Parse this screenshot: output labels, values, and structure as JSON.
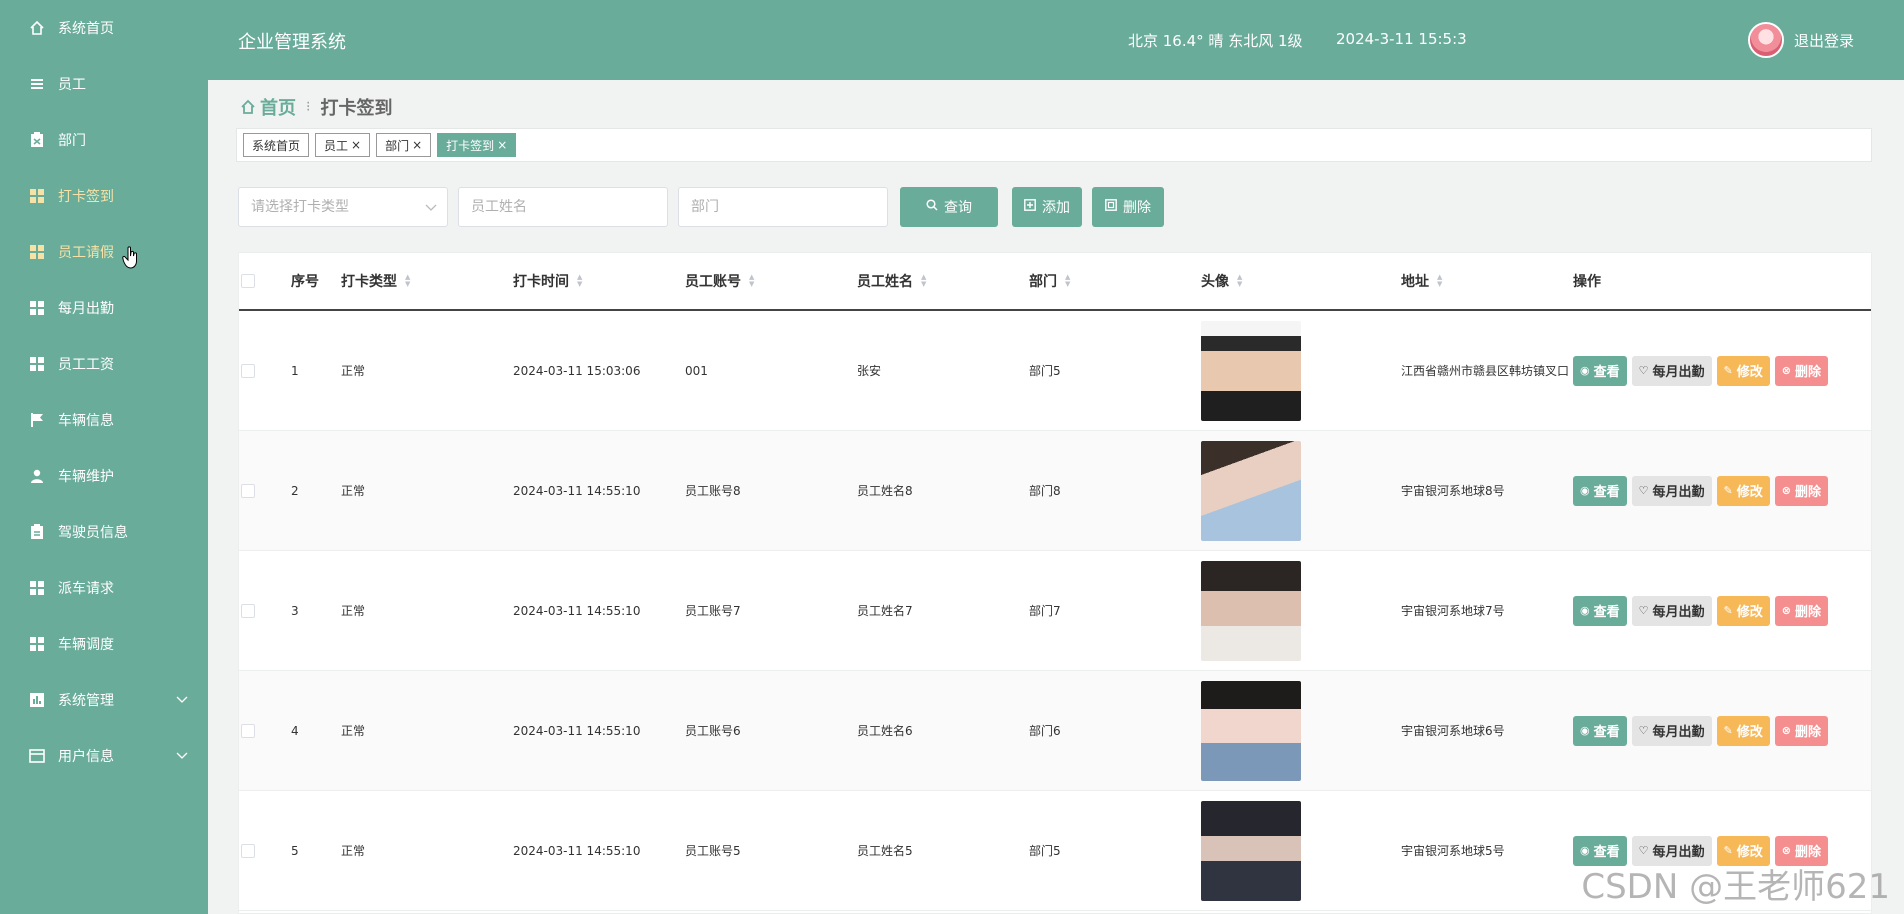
{
  "colors": {
    "primary": "#6aac9a",
    "active_menu": "#f6e2a6",
    "edit": "#f7b858",
    "delete": "#f58e8e",
    "monthly": "#e4e4e4"
  },
  "sidebar": {
    "items": [
      {
        "label": "系统首页",
        "icon": "home-icon"
      },
      {
        "label": "员工",
        "icon": "list-icon"
      },
      {
        "label": "部门",
        "icon": "clipboard-icon"
      },
      {
        "label": "打卡签到",
        "icon": "grid-icon"
      },
      {
        "label": "员工请假",
        "icon": "grid-icon"
      },
      {
        "label": "每月出勤",
        "icon": "grid-icon"
      },
      {
        "label": "员工工资",
        "icon": "grid-icon"
      },
      {
        "label": "车辆信息",
        "icon": "flag-icon"
      },
      {
        "label": "车辆维护",
        "icon": "user-icon"
      },
      {
        "label": "驾驶员信息",
        "icon": "clipboard-icon"
      },
      {
        "label": "派车请求",
        "icon": "grid-icon"
      },
      {
        "label": "车辆调度",
        "icon": "grid-icon"
      },
      {
        "label": "系统管理",
        "icon": "chart-icon"
      },
      {
        "label": "用户信息",
        "icon": "card-icon"
      }
    ]
  },
  "header": {
    "title": "企业管理系统",
    "weather": "北京  16.4°  晴  东北风  1级",
    "datetime": "2024-3-11 15:5:3",
    "logout": "退出登录"
  },
  "breadcrumb": {
    "home": "首页",
    "current": "打卡签到"
  },
  "tags": [
    {
      "label": "系统首页",
      "closable": false
    },
    {
      "label": "员工",
      "closable": true
    },
    {
      "label": "部门",
      "closable": true
    },
    {
      "label": "打卡签到",
      "closable": true
    }
  ],
  "filters": {
    "type_placeholder": "请选择打卡类型",
    "name_placeholder": "员工姓名",
    "dept_placeholder": "部门",
    "search": "查询",
    "add": "添加",
    "delete": "删除"
  },
  "table": {
    "columns": [
      "序号",
      "打卡类型",
      "打卡时间",
      "员工账号",
      "员工姓名",
      "部门",
      "头像",
      "地址",
      "操作"
    ],
    "actions": {
      "view": "查看",
      "monthly": "每月出勤",
      "edit": "修改",
      "delete": "删除"
    },
    "rows": [
      {
        "no": "1",
        "type": "正常",
        "time": "2024-03-11 15:03:06",
        "account": "001",
        "name": "张安",
        "dept": "部门5",
        "address": "江西省赣州市赣县区韩坊镇叉口"
      },
      {
        "no": "2",
        "type": "正常",
        "time": "2024-03-11 14:55:10",
        "account": "员工账号8",
        "name": "员工姓名8",
        "dept": "部门8",
        "address": "宇宙银河系地球8号"
      },
      {
        "no": "3",
        "type": "正常",
        "time": "2024-03-11 14:55:10",
        "account": "员工账号7",
        "name": "员工姓名7",
        "dept": "部门7",
        "address": "宇宙银河系地球7号"
      },
      {
        "no": "4",
        "type": "正常",
        "time": "2024-03-11 14:55:10",
        "account": "员工账号6",
        "name": "员工姓名6",
        "dept": "部门6",
        "address": "宇宙银河系地球6号"
      },
      {
        "no": "5",
        "type": "正常",
        "time": "2024-03-11 14:55:10",
        "account": "员工账号5",
        "name": "员工姓名5",
        "dept": "部门5",
        "address": "宇宙银河系地球5号"
      }
    ]
  },
  "watermark": "CSDN @王老师621"
}
